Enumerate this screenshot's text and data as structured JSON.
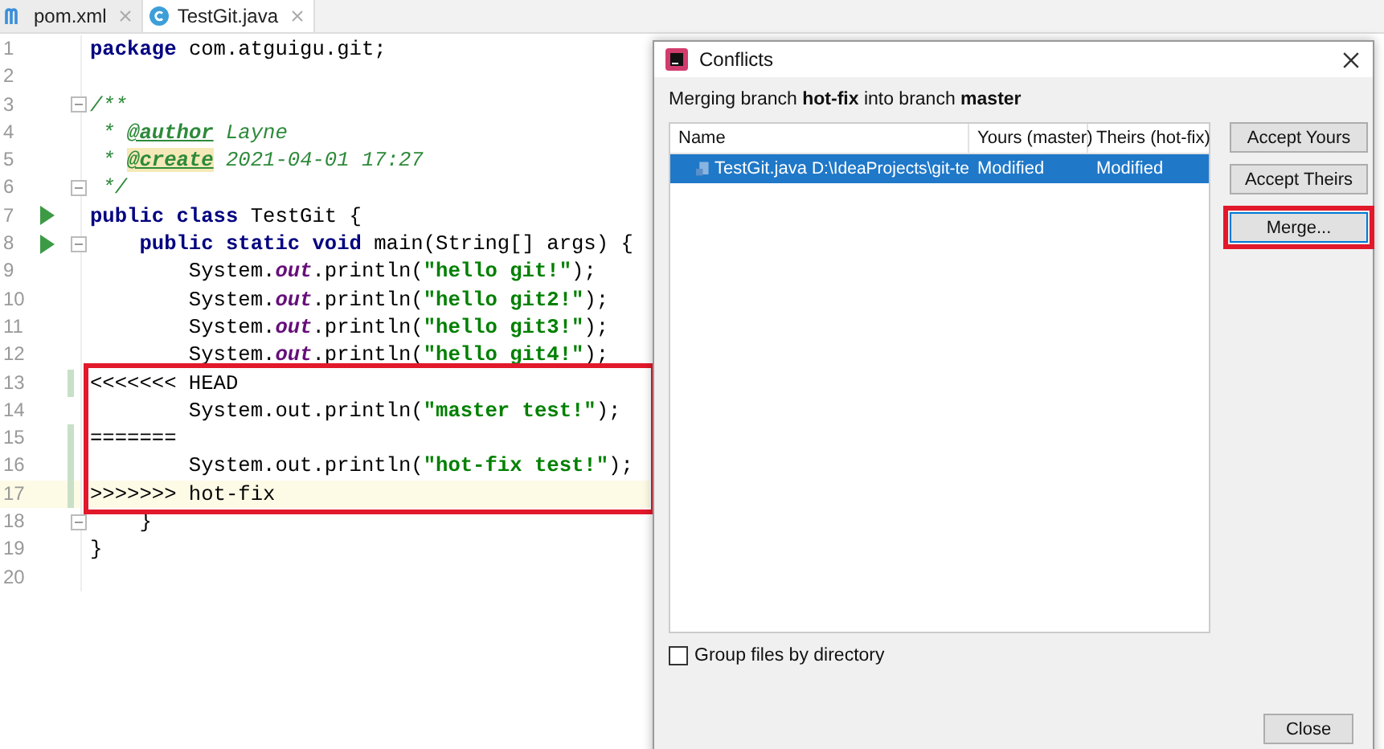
{
  "editor_tabs": [
    {
      "label": "pom.xml",
      "selected": false
    },
    {
      "label": "TestGit.java",
      "selected": true
    }
  ],
  "code": {
    "blocks": [
      {
        "boxed": false,
        "lines": [
          {
            "number": "1",
            "run": false,
            "fold": false,
            "changed": false,
            "current": false,
            "tokens": [
              {
                "kind": "keyword",
                "text": "package"
              },
              {
                "kind": "plain",
                "text": " com.atguigu.git;"
              }
            ]
          },
          {
            "number": "2",
            "run": false,
            "fold": false,
            "changed": false,
            "current": false
          },
          {
            "number": "3",
            "run": false,
            "fold": true,
            "changed": false,
            "current": false,
            "tokens": [
              {
                "kind": "comment",
                "text": "/**"
              }
            ]
          },
          {
            "number": "4",
            "run": false,
            "fold": false,
            "changed": false,
            "current": false,
            "tokens": [
              {
                "kind": "comment",
                "text": " * "
              },
              {
                "kind": "doctag",
                "text": "@author"
              },
              {
                "kind": "comment",
                "text": " Layne"
              }
            ]
          },
          {
            "number": "5",
            "run": false,
            "fold": false,
            "changed": false,
            "current": false,
            "tokens": [
              {
                "kind": "comment",
                "text": " * "
              },
              {
                "kind": "doctag-marked",
                "text": "@create"
              },
              {
                "kind": "comment",
                "text": " 2021-04-01 17:27"
              }
            ]
          },
          {
            "number": "6",
            "run": false,
            "fold": true,
            "changed": false,
            "current": false,
            "tokens": [
              {
                "kind": "comment",
                "text": " */"
              }
            ]
          },
          {
            "number": "7",
            "run": true,
            "fold": false,
            "changed": false,
            "current": false,
            "tokens": [
              {
                "kind": "keyword",
                "text": "public class"
              },
              {
                "kind": "plain",
                "text": " TestGit {"
              }
            ]
          },
          {
            "number": "8",
            "run": true,
            "fold": true,
            "changed": false,
            "current": false,
            "tokens": [
              {
                "kind": "keyword",
                "text": "    public static void"
              },
              {
                "kind": "plain",
                "text": " main(String[] args) {"
              }
            ]
          },
          {
            "number": "9",
            "run": false,
            "fold": false,
            "changed": false,
            "current": false,
            "tokens": [
              {
                "kind": "plain",
                "text": "        System."
              },
              {
                "kind": "field",
                "text": "out"
              },
              {
                "kind": "plain",
                "text": ".println("
              },
              {
                "kind": "string",
                "text": "\"hello git!\""
              },
              {
                "kind": "plain",
                "text": ");"
              }
            ]
          },
          {
            "number": "10",
            "run": false,
            "fold": false,
            "changed": false,
            "current": false,
            "tokens": [
              {
                "kind": "plain",
                "text": "        System."
              },
              {
                "kind": "field",
                "text": "out"
              },
              {
                "kind": "plain",
                "text": ".println("
              },
              {
                "kind": "string",
                "text": "\"hello git2!\""
              },
              {
                "kind": "plain",
                "text": ");"
              }
            ]
          },
          {
            "number": "11",
            "run": false,
            "fold": false,
            "changed": false,
            "current": false,
            "tokens": [
              {
                "kind": "plain",
                "text": "        System."
              },
              {
                "kind": "field",
                "text": "out"
              },
              {
                "kind": "plain",
                "text": ".println("
              },
              {
                "kind": "string",
                "text": "\"hello git3!\""
              },
              {
                "kind": "plain",
                "text": ");"
              }
            ]
          },
          {
            "number": "12",
            "run": false,
            "fold": false,
            "changed": false,
            "current": false,
            "tokens": [
              {
                "kind": "plain",
                "text": "        System."
              },
              {
                "kind": "field",
                "text": "out"
              },
              {
                "kind": "plain",
                "text": ".println("
              },
              {
                "kind": "string",
                "text": "\"hello git4!\""
              },
              {
                "kind": "plain",
                "text": ");"
              }
            ]
          }
        ]
      },
      {
        "boxed": true,
        "lines": [
          {
            "number": "13",
            "run": false,
            "fold": false,
            "changed": true,
            "current": false,
            "tokens": [
              {
                "kind": "plain",
                "text": "<<<<<<< HEAD"
              }
            ]
          },
          {
            "number": "14",
            "run": false,
            "fold": false,
            "changed": false,
            "current": false,
            "tokens": [
              {
                "kind": "plain",
                "text": "        System.out.println("
              },
              {
                "kind": "string",
                "text": "\"master test!\""
              },
              {
                "kind": "plain",
                "text": ");"
              }
            ]
          },
          {
            "number": "15",
            "run": false,
            "fold": false,
            "changed": true,
            "current": false,
            "tokens": [
              {
                "kind": "plain",
                "text": "======="
              }
            ]
          },
          {
            "number": "16",
            "run": false,
            "fold": false,
            "changed": true,
            "current": false,
            "tokens": [
              {
                "kind": "plain",
                "text": "        System.out.println("
              },
              {
                "kind": "string",
                "text": "\"hot-fix test!\""
              },
              {
                "kind": "plain",
                "text": ");"
              }
            ]
          },
          {
            "number": "17",
            "run": false,
            "fold": false,
            "changed": true,
            "current": true,
            "tokens": [
              {
                "kind": "plain",
                "text": ">>>>>>> hot-fix"
              }
            ]
          }
        ]
      },
      {
        "boxed": false,
        "lines": [
          {
            "number": "18",
            "run": false,
            "fold": true,
            "changed": false,
            "current": false,
            "tokens": [
              {
                "kind": "plain",
                "text": "    }"
              }
            ]
          },
          {
            "number": "19",
            "run": false,
            "fold": false,
            "changed": false,
            "current": false,
            "tokens": [
              {
                "kind": "plain",
                "text": "}"
              }
            ]
          },
          {
            "number": "20",
            "run": false,
            "fold": false,
            "changed": false,
            "current": false
          }
        ]
      }
    ]
  },
  "dialog": {
    "title": "Conflicts",
    "subtitle": "Merging branch **hot-fix** into branch **master**",
    "table": {
      "columns": [
        "Name",
        "Yours (master)",
        "Theirs (hot-fix)"
      ],
      "rows": [
        {
          "name": "TestGit.java",
          "path": "D:\\IdeaProjects\\git-te",
          "yours": "Modified",
          "theirs": "Modified",
          "selected": true
        }
      ]
    },
    "buttons": [
      {
        "label": "Accept Yours",
        "boxed": false
      },
      {
        "label": "Accept Theirs",
        "boxed": false
      },
      {
        "label": "Merge...",
        "boxed": true
      }
    ],
    "group_by_directory": {
      "label": "Group files by directory",
      "checked": false
    },
    "close_button": "Close"
  }
}
